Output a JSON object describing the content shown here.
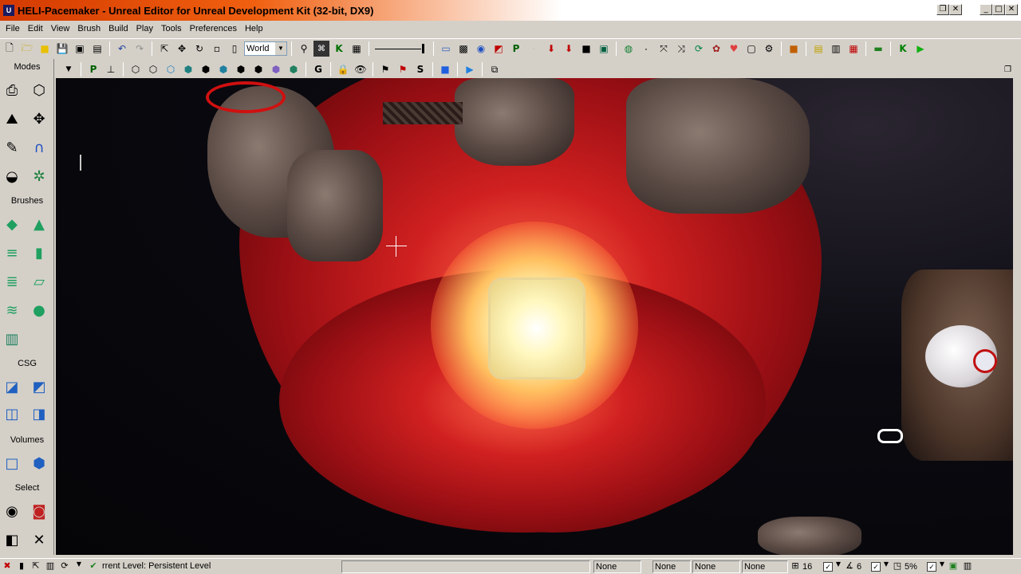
{
  "window": {
    "title": "HELI-Pacemaker - Unreal Editor for Unreal Development Kit (32-bit, DX9)"
  },
  "menu": [
    "File",
    "Edit",
    "View",
    "Brush",
    "Build",
    "Play",
    "Tools",
    "Preferences",
    "Help"
  ],
  "toolbar": {
    "coord_system": "World"
  },
  "modes_panel": {
    "modes_label": "Modes",
    "brushes_label": "Brushes",
    "csg_label": "CSG",
    "volumes_label": "Volumes",
    "select_label": "Select"
  },
  "status": {
    "current_level_label": "rrent Level:",
    "current_level_value": "Persistent Level",
    "slot1": "None",
    "slot2": "None",
    "slot3": "None",
    "slot4": "None",
    "grid_value": "16",
    "rotation_value": "6",
    "scale_value": "5%"
  },
  "colors": {
    "title_gradient_start": "#d43a00",
    "ui_face": "#d4d0c8",
    "flesh_red": "#c01818",
    "glow": "#fff4b0"
  }
}
